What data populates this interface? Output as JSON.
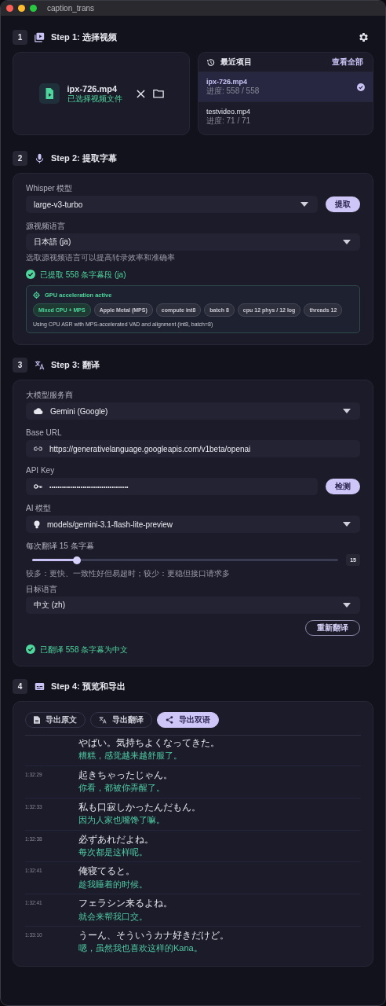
{
  "window": {
    "title": "caption_trans"
  },
  "step1": {
    "number": "1",
    "title": "Step 1: 选择视频",
    "file": {
      "name": "ipx-726.mp4",
      "status": "已选择视频文件"
    },
    "recent": {
      "title": "最近项目",
      "view_all": "查看全部",
      "items": [
        {
          "name": "ipx-726.mp4",
          "progress": "进度: 558 / 558",
          "selected": true
        },
        {
          "name": "testvideo.mp4",
          "progress": "进度: 71 / 71",
          "selected": false
        }
      ]
    }
  },
  "step2": {
    "number": "2",
    "title": "Step 2: 提取字幕",
    "model_label": "Whisper 模型",
    "model": "large-v3-turbo",
    "extract_button": "提取",
    "language_label": "源视频语言",
    "language": "日本語 (ja)",
    "language_hint": "选取源视频语言可以提高转录效率和准确率",
    "status": "已提取 558 条字幕段 (ja)",
    "gpu": {
      "title": "GPU acceleration active",
      "tags": [
        {
          "label": "Mixed CPU + MPS",
          "kind": "primary"
        },
        {
          "label": "Apple Metal (MPS)",
          "kind": "plain"
        },
        {
          "label": "compute int8",
          "kind": "plain"
        },
        {
          "label": "batch 8",
          "kind": "plain"
        },
        {
          "label": "cpu 12 phys / 12 log",
          "kind": "plain"
        },
        {
          "label": "threads 12",
          "kind": "plain"
        }
      ],
      "note": "Using CPU ASR with MPS-accelerated VAD and alignment (int8, batch=8)"
    }
  },
  "step3": {
    "number": "3",
    "title": "Step 3: 翻译",
    "provider_label": "大模型服务商",
    "provider": "Gemini (Google)",
    "base_url_label": "Base URL",
    "base_url": "https://generativelanguage.googleapis.com/v1beta/openai",
    "api_key_label": "API Key",
    "api_key": "••••••••••••••••••••••••••••••••••••••",
    "test_button": "检测",
    "ai_model_label": "AI 模型",
    "ai_model": "models/gemini-3.1-flash-lite-preview",
    "batch_label": "每次翻译 15 条字幕",
    "batch": {
      "level": 0.145,
      "reading": "15"
    },
    "batch_hint": "较多：更快、一致性好但易超时；较少：更稳但接口请求多",
    "target_label": "目标语言",
    "target": "中文 (zh)",
    "retranslate_button": "重新翻译",
    "status": "已翻译 558 条字幕为中文"
  },
  "step4": {
    "number": "4",
    "title": "Step 4: 预览和导出",
    "export_buttons": [
      {
        "label": "导出原文",
        "kind": "original",
        "selected": false
      },
      {
        "label": "导出翻译",
        "kind": "translation",
        "selected": false
      },
      {
        "label": "导出双语",
        "kind": "bilingual",
        "selected": true
      }
    ],
    "subtitles": [
      {
        "original": "やばい。気持ちよくなってきた。",
        "translation": "糟糕，感觉越来越舒服了。"
      },
      {
        "time": "1:32:29",
        "original": "起きちゃったじゃん。",
        "translation": "你看，都被你弄醒了。"
      },
      {
        "time": "1:32:33",
        "original": "私も口寂しかったんだもん。",
        "translation": "因为人家也嘴馋了嘛。"
      },
      {
        "time": "1:32:38",
        "original": "必ずあれだよね。",
        "translation": "每次都是这样呢。"
      },
      {
        "time": "1:32:41",
        "original": "俺寝てると。",
        "translation": "趁我睡着的时候。"
      },
      {
        "time": "1:32:41",
        "original": "フェラシン来るよね。",
        "translation": "就会来帮我口交。"
      },
      {
        "time": "1:33:10",
        "original": "うーん、そういうカナ好きだけど。",
        "translation": "嗯，虽然我也喜欢这样的Kana。"
      }
    ]
  }
}
